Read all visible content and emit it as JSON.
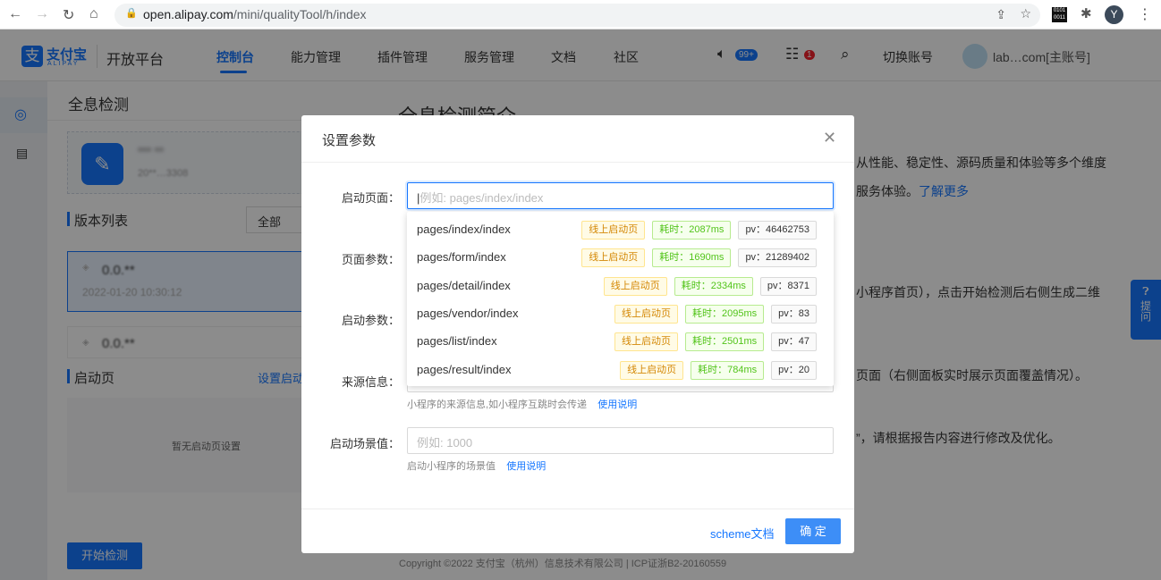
{
  "browser": {
    "url_host": "open.alipay.com",
    "url_path": "/mini/qualityTool/h/index",
    "profile_initial": "Y"
  },
  "header": {
    "logo_cn": "支付宝",
    "logo_en": "ALIPAY",
    "platform": "开放平台",
    "nav": [
      {
        "label": "控制台",
        "active": true
      },
      {
        "label": "能力管理"
      },
      {
        "label": "插件管理"
      },
      {
        "label": "服务管理"
      },
      {
        "label": "文档"
      },
      {
        "label": "社区"
      }
    ],
    "notice_badge": "99+",
    "task_badge": "1",
    "switch_account": "切换账号",
    "account": "lab…com[主账号]"
  },
  "left": {
    "title": "全息检测",
    "app_name": "*** **",
    "app_id": "20**…3308",
    "version_list": "版本列表",
    "filter": "全部",
    "versions": [
      {
        "version": "0.0.**",
        "time": "2022-01-20 10:30:12"
      },
      {
        "version": "0.0.**"
      }
    ],
    "launch_page": "启动页",
    "set_launch_link": "设置启动页",
    "empty": "暂无启动页设置",
    "start_button": "开始检测"
  },
  "main": {
    "title": "全息检测简介",
    "lines": [
      "从性能、稳定性、源码质量和体验等多个维度",
      "服务体验。",
      "小程序首页），点击开始检测后右侧生成二维",
      "页面（右侧面板实时展示页面覆盖情况）。",
      "”，请根据报告内容进行修改及优化。"
    ],
    "learn_more": "了解更多",
    "ask": "提问",
    "footer": "Copyright ©2022 支付宝（杭州）信息技术有限公司 | ICP证浙B2-20160559"
  },
  "modal": {
    "title": "设置参数",
    "fields": {
      "start_page": "启动页面：",
      "start_page_placeholder": "例如: pages/index/index",
      "page_params": "页面参数：",
      "start_params": "启动参数：",
      "source": "来源信息：",
      "source_hint": "小程序的来源信息,如小程序互跳时会传递",
      "scene": "启动场景值：",
      "scene_placeholder": "例如: 1000",
      "scene_hint": "启动小程序的场景值",
      "usage": "使用说明"
    },
    "suggestions": [
      {
        "page": "pages/index/index",
        "tag": "线上启动页",
        "time": "耗时：2087ms",
        "pv": "pv：46462753"
      },
      {
        "page": "pages/form/index",
        "tag": "线上启动页",
        "time": "耗时：1690ms",
        "pv": "pv：21289402"
      },
      {
        "page": "pages/detail/index",
        "tag": "线上启动页",
        "time": "耗时：2334ms",
        "pv": "pv：8371"
      },
      {
        "page": "pages/vendor/index",
        "tag": "线上启动页",
        "time": "耗时：2095ms",
        "pv": "pv：83"
      },
      {
        "page": "pages/list/index",
        "tag": "线上启动页",
        "time": "耗时：2501ms",
        "pv": "pv：47"
      },
      {
        "page": "pages/result/index",
        "tag": "线上启动页",
        "time": "耗时：784ms",
        "pv": "pv：20"
      }
    ],
    "scheme_doc": "scheme文档",
    "confirm": "确 定"
  }
}
